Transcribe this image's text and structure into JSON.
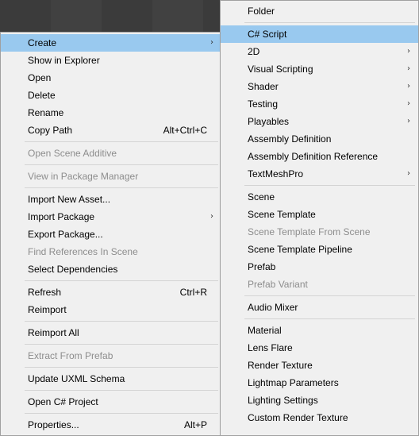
{
  "main_menu": [
    {
      "type": "item",
      "label": "Create",
      "submenu": true,
      "highlighted": true
    },
    {
      "type": "item",
      "label": "Show in Explorer"
    },
    {
      "type": "item",
      "label": "Open"
    },
    {
      "type": "item",
      "label": "Delete"
    },
    {
      "type": "item",
      "label": "Rename"
    },
    {
      "type": "item",
      "label": "Copy Path",
      "shortcut": "Alt+Ctrl+C"
    },
    {
      "type": "sep"
    },
    {
      "type": "item",
      "label": "Open Scene Additive",
      "disabled": true
    },
    {
      "type": "sep"
    },
    {
      "type": "item",
      "label": "View in Package Manager",
      "disabled": true
    },
    {
      "type": "sep"
    },
    {
      "type": "item",
      "label": "Import New Asset..."
    },
    {
      "type": "item",
      "label": "Import Package",
      "submenu": true
    },
    {
      "type": "item",
      "label": "Export Package..."
    },
    {
      "type": "item",
      "label": "Find References In Scene",
      "disabled": true
    },
    {
      "type": "item",
      "label": "Select Dependencies"
    },
    {
      "type": "sep"
    },
    {
      "type": "item",
      "label": "Refresh",
      "shortcut": "Ctrl+R"
    },
    {
      "type": "item",
      "label": "Reimport"
    },
    {
      "type": "sep"
    },
    {
      "type": "item",
      "label": "Reimport All"
    },
    {
      "type": "sep"
    },
    {
      "type": "item",
      "label": "Extract From Prefab",
      "disabled": true
    },
    {
      "type": "sep"
    },
    {
      "type": "item",
      "label": "Update UXML Schema"
    },
    {
      "type": "sep"
    },
    {
      "type": "item",
      "label": "Open C# Project"
    },
    {
      "type": "sep"
    },
    {
      "type": "item",
      "label": "Properties...",
      "shortcut": "Alt+P"
    }
  ],
  "create_submenu": [
    {
      "type": "item",
      "label": "Folder"
    },
    {
      "type": "sep"
    },
    {
      "type": "item",
      "label": "C# Script",
      "highlighted": true
    },
    {
      "type": "item",
      "label": "2D",
      "submenu": true
    },
    {
      "type": "item",
      "label": "Visual Scripting",
      "submenu": true
    },
    {
      "type": "item",
      "label": "Shader",
      "submenu": true
    },
    {
      "type": "item",
      "label": "Testing",
      "submenu": true
    },
    {
      "type": "item",
      "label": "Playables",
      "submenu": true
    },
    {
      "type": "item",
      "label": "Assembly Definition"
    },
    {
      "type": "item",
      "label": "Assembly Definition Reference"
    },
    {
      "type": "item",
      "label": "TextMeshPro",
      "submenu": true
    },
    {
      "type": "sep"
    },
    {
      "type": "item",
      "label": "Scene"
    },
    {
      "type": "item",
      "label": "Scene Template"
    },
    {
      "type": "item",
      "label": "Scene Template From Scene",
      "disabled": true
    },
    {
      "type": "item",
      "label": "Scene Template Pipeline"
    },
    {
      "type": "item",
      "label": "Prefab"
    },
    {
      "type": "item",
      "label": "Prefab Variant",
      "disabled": true
    },
    {
      "type": "sep"
    },
    {
      "type": "item",
      "label": "Audio Mixer"
    },
    {
      "type": "sep"
    },
    {
      "type": "item",
      "label": "Material"
    },
    {
      "type": "item",
      "label": "Lens Flare"
    },
    {
      "type": "item",
      "label": "Render Texture"
    },
    {
      "type": "item",
      "label": "Lightmap Parameters"
    },
    {
      "type": "item",
      "label": "Lighting Settings"
    },
    {
      "type": "item",
      "label": "Custom Render Texture"
    }
  ],
  "arrow_glyph": "›",
  "colors": {
    "menu_bg": "#f0f0f0",
    "highlight": "#99c9ef",
    "disabled_text": "#8d8d8d",
    "separator": "#d4d4d4"
  }
}
